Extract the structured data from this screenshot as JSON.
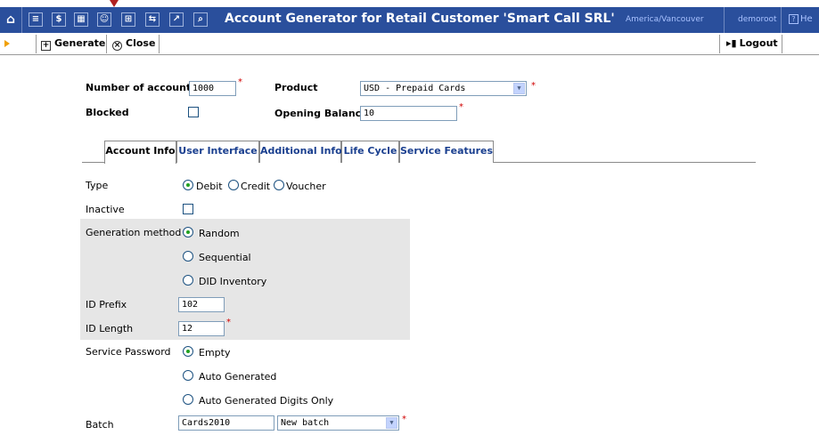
{
  "titlebar": {
    "title": "Account Generator for Retail Customer 'Smart Call SRL'",
    "timezone": "America/Vancouver",
    "user": "demoroot",
    "help": "He",
    "help_glyph": "?",
    "icons": [
      "home-icon",
      "list-icon",
      "dollar-icon",
      "grid-icon",
      "person-icon",
      "network-icon",
      "transfer-icon",
      "chart-icon",
      "search-icon"
    ],
    "color": "#2a4f9c"
  },
  "toolbar": {
    "generate_label": "Generate",
    "close_label": "Close",
    "logout_label": "Logout"
  },
  "form": {
    "number_of_accounts_label": "Number of accounts",
    "number_of_accounts_value": "1000",
    "product_label": "Product",
    "product_value": "USD - Prepaid Cards",
    "blocked_label": "Blocked",
    "opening_balance_label": "Opening Balance",
    "opening_balance_value": "10",
    "required_mark": "*"
  },
  "tabs": [
    "Account Info",
    "User Interface",
    "Additional Info",
    "Life Cycle",
    "Service Features"
  ],
  "account_info": {
    "type_label": "Type",
    "type_options": [
      "Debit",
      "Credit",
      "Voucher"
    ],
    "type_selected": "Debit",
    "inactive_label": "Inactive",
    "generation_method_label": "Generation method",
    "generation_options": [
      "Random",
      "Sequential",
      "DID Inventory"
    ],
    "generation_selected": "Random",
    "id_prefix_label": "ID Prefix",
    "id_prefix_value": "102",
    "id_length_label": "ID Length",
    "id_length_value": "12",
    "service_password_label": "Service Password",
    "password_options": [
      "Empty",
      "Auto Generated",
      "Auto Generated Digits Only"
    ],
    "password_selected": "Empty",
    "batch_label": "Batch",
    "batch_value": "Cards2010",
    "batch_select_value": "New batch"
  }
}
